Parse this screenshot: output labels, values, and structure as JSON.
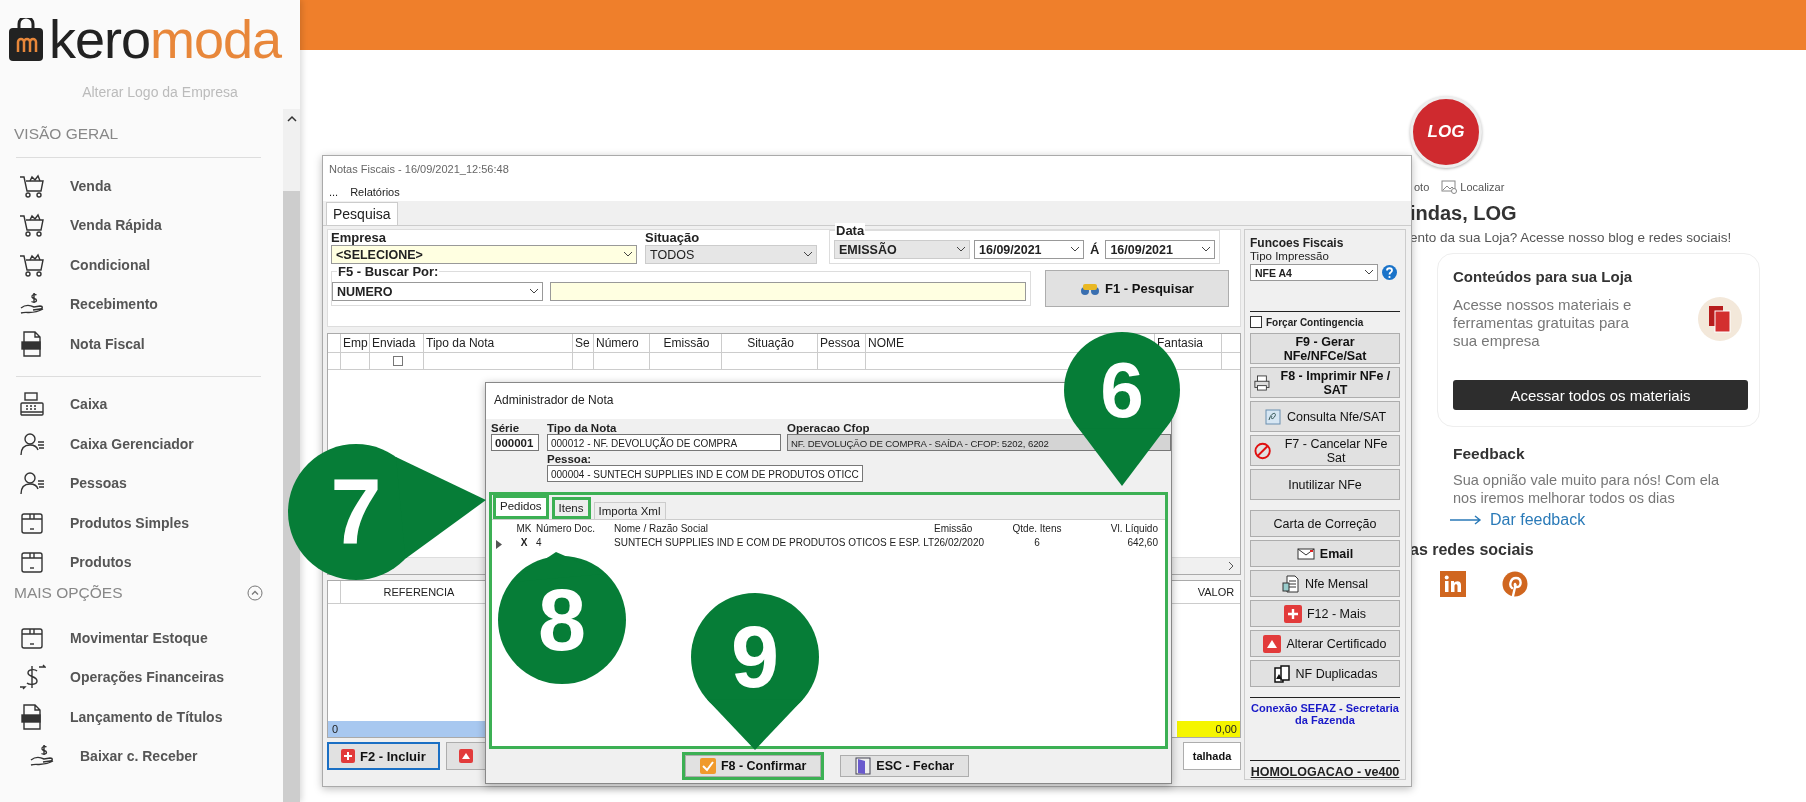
{
  "sidebar": {
    "logo": {
      "dark_part": "kero",
      "accent_part": "moda"
    },
    "change_logo": "Alterar Logo da Empresa",
    "sections": [
      {
        "title": "VISÃO GERAL",
        "groups": [
          {
            "items": [
              {
                "label": "Venda"
              },
              {
                "label": "Venda Rápida"
              },
              {
                "label": "Condicional"
              },
              {
                "label": "Recebimento"
              },
              {
                "label": "Nota Fiscal"
              }
            ]
          },
          {
            "items": [
              {
                "label": "Caixa"
              },
              {
                "label": "Caixa Gerenciador"
              },
              {
                "label": "Pessoas"
              },
              {
                "label": "Produtos Simples"
              },
              {
                "label": "Produtos"
              }
            ]
          }
        ]
      },
      {
        "title": "MAIS OPÇÕES",
        "expanded": true,
        "groups": [
          {
            "items": [
              {
                "label": "Movimentar Estoque"
              },
              {
                "label": "Operações Financeiras"
              },
              {
                "label": "Lançamento de Títulos",
                "children": [
                  {
                    "label": "Baixar c. Receber"
                  }
                ]
              }
            ]
          }
        ]
      }
    ]
  },
  "home": {
    "avatar_text": "LOG",
    "actions": [
      {
        "label": "oto"
      },
      {
        "label": "Localizar"
      }
    ],
    "greeting": "indas, LOG",
    "subtitle": "ento da sua Loja? Acesse nosso blog e redes sociais!",
    "card": {
      "title": "Conteúdos para sua Loja",
      "text": "Acesse nossos materiais e ferramentas gratuitas para sua empresa",
      "button": "Acessar todos os materiais"
    },
    "feedback": {
      "title": "Feedback",
      "text": "Sua opnião vale muito para nós! Com ela nos iremos melhorar todos os dias",
      "link": "Dar feedback"
    },
    "social_title": "as redes sociais"
  },
  "notas_window": {
    "title": "Notas Fiscais - 16/09/2021_12:56:48",
    "menu": [
      "...",
      "Relatórios"
    ],
    "tabs": [
      {
        "label": "Pesquisa",
        "selected": true
      }
    ],
    "filters": {
      "empresa": {
        "label": "Empresa",
        "value": "<SELECIONE>"
      },
      "situacao": {
        "label": "Situação",
        "value": "TODOS"
      },
      "data": {
        "label": "Data",
        "type": "EMISSÃO",
        "from": "16/09/2021",
        "separator": "Á",
        "to": "16/09/2021"
      },
      "buscar": {
        "label": "F5 - Buscar Por:",
        "field": "NUMERO"
      }
    },
    "search_button": "F1 - Pesquisar",
    "grid": {
      "columns": [
        "Emp",
        "Enviada",
        "Tipo da Nota",
        "Se",
        "Número",
        "Emissão",
        "Situação",
        "Pessoa",
        "NOME",
        "Fantasia"
      ],
      "rows": [
        {
          "sent": false
        }
      ]
    },
    "items_grid": {
      "columns": [
        "REFERENCIA",
        "VALOR"
      ],
      "totals": [
        "0",
        "0,00"
      ]
    },
    "bottom_buttons": [
      {
        "label": "F2 - Incluir",
        "focused": true
      },
      {
        "label": "talhada",
        "focused": false
      }
    ],
    "fiscal_panel": {
      "title": "Funcoes Fiscais",
      "print_label": "Tipo Impressão",
      "print_type": "NFE A4",
      "contingency": {
        "label": "Forçar Contingencia",
        "checked": false
      },
      "button_groups": [
        {
          "buttons": [
            {
              "label": "F9 - Gerar NFe/NFCe/Sat",
              "bold": true
            },
            {
              "label": "F8 - Imprimir NFe / SAT",
              "bold": true
            },
            {
              "label": "Consulta Nfe/SAT",
              "bold": false
            },
            {
              "label": "F7 - Cancelar NFe Sat",
              "bold": false
            },
            {
              "label": "Inutilizar NFe",
              "bold": false
            }
          ]
        },
        {
          "buttons": [
            {
              "label": "Carta de Correção",
              "bold": false
            },
            {
              "label": "Email",
              "bold": true
            },
            {
              "label": "Nfe Mensal",
              "bold": false
            },
            {
              "label": "F12 - Mais",
              "bold": false
            },
            {
              "label": "Alterar Certificado",
              "bold": false
            },
            {
              "label": "NF Duplicadas",
              "bold": false
            }
          ]
        }
      ],
      "sefaz_link": "Conexão SEFAZ - Secretaria da Fazenda",
      "environment": "HOMOLOGACAO - ve400"
    }
  },
  "dialog": {
    "title": "Administrador de Nota",
    "serie": {
      "label": "Série",
      "value": "000001"
    },
    "tipo": {
      "label": "Tipo da Nota",
      "value": "000012 - NF. DEVOLUÇÃO DE COMPRA"
    },
    "cfop": {
      "label": "Operacao Cfop",
      "value": "NF. DEVOLUÇÃO DE COMPRA - SAÍDA - CFOP: 5202, 6202"
    },
    "pessoa": {
      "label": "Pessoa:",
      "value": "000004 - SUNTECH SUPPLIES IND E COM DE PRODUTOS OTICC"
    },
    "highlighted": true,
    "tabs": [
      {
        "label": "Pedidos",
        "selected": true,
        "highlighted": true
      },
      {
        "label": "Itens",
        "selected": false,
        "highlighted": true
      },
      {
        "label": "Importa Xml",
        "selected": false,
        "highlighted": false
      }
    ],
    "columns": [
      "MK",
      "Número Doc.",
      "Nome / Razão Social",
      "Emissão",
      "Qtde. Itens",
      "Vl. Líquido"
    ],
    "rows": [
      {
        "current": true,
        "cells": [
          "X",
          "4",
          "SUNTECH SUPPLIES IND E COM DE PRODUTOS OTICOS E ESP. LT",
          "26/02/2020",
          "6",
          "642,60"
        ]
      }
    ],
    "buttons": [
      {
        "label": "F8 - Confirmar",
        "highlighted": true
      },
      {
        "label": "ESC - Fechar",
        "highlighted": false
      }
    ]
  },
  "callouts": [
    {
      "number": "6"
    },
    {
      "number": "7"
    },
    {
      "number": "8"
    },
    {
      "number": "9"
    }
  ]
}
